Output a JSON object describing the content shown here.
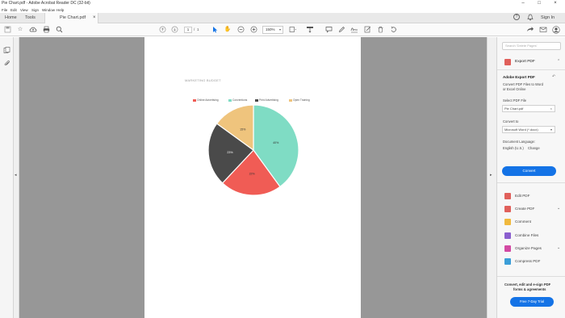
{
  "window": {
    "title": "Pie Chart.pdf - Adobe Acrobat Reader DC (32-bit)",
    "controls": [
      "–",
      "□",
      "×"
    ]
  },
  "menu": [
    "File",
    "Edit",
    "View",
    "Sign",
    "Window",
    "Help"
  ],
  "tabs": {
    "home": "Home",
    "tools": "Tools",
    "document": "Pie Chart.pdf",
    "close": "×"
  },
  "topright": {
    "signin": "Sign In"
  },
  "toolbar": {
    "page_current": "1",
    "page_sep": "/",
    "page_total": "1",
    "zoom": "150%"
  },
  "document": {
    "heading": "MARKETING BUDGET",
    "chart_data": {
      "type": "pie",
      "title": "MARKETING BUDGET",
      "labels": [
        "Online Advertising",
        "Conventions",
        "Print Advertising",
        "Open Training"
      ],
      "values": [
        22,
        40,
        23,
        15
      ],
      "slice_labels": [
        "22%",
        "40%",
        "23%",
        "15%"
      ],
      "colors": [
        "#f05c55",
        "#7fdcc4",
        "#4a4a4a",
        "#efc47d"
      ],
      "legend_position": "top"
    }
  },
  "pane": {
    "search_placeholder": "Search 'Delete Pages'",
    "export_pdf": "Export PDF",
    "adobe_export_pdf": "Adobe Export PDF",
    "desc_line1": "Convert PDF Files to Word",
    "desc_line2": "or Excel Online",
    "select_label": "Select PDF File",
    "select_value": "Pie Chart.pdf",
    "convert_to_label": "Convert to",
    "convert_to_value": "Microsoft Word (*.docx)",
    "doc_lang_label": "Document Language:",
    "doc_lang_value": "English (U.S.)",
    "doc_lang_change": "Change",
    "convert_button": "Convert",
    "tools": [
      "Edit PDF",
      "Create PDF",
      "Comment",
      "Combine Files",
      "Organize Pages",
      "Compress PDF"
    ],
    "tool_colors": [
      "#e0605b",
      "#e0605b",
      "#f0b93d",
      "#8b5fcf",
      "#d34aa3",
      "#3b9ed8"
    ],
    "promo_line1": "Convert, edit and e-sign PDF",
    "promo_line2": "forms & agreements",
    "trial_button": "Free 7-Day Trial"
  }
}
